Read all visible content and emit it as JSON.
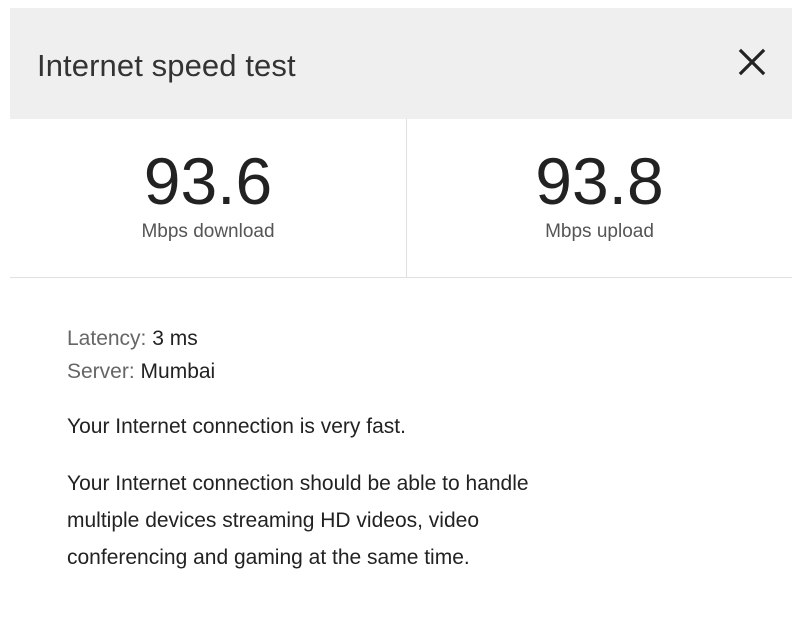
{
  "dialog": {
    "title": "Internet speed test",
    "close_label": "×"
  },
  "metrics": {
    "download": {
      "value": "93.6",
      "unit": "Mbps download"
    },
    "upload": {
      "value": "93.8",
      "unit": "Mbps upload"
    }
  },
  "details": {
    "latency_label": "Latency:",
    "latency_value": "3 ms",
    "server_label": "Server:",
    "server_value": "Mumbai",
    "summary": "Your Internet connection is very fast.",
    "description_lines": [
      "Your Internet connection should be able to handle",
      "multiple devices streaming HD videos, video",
      "conferencing and gaming at the same time."
    ]
  },
  "icons": {
    "close": "close-icon"
  },
  "colors": {
    "header_background": "#efefef",
    "divider": "#e0e0e0",
    "primary_text": "#222222",
    "secondary_text": "#666666"
  }
}
